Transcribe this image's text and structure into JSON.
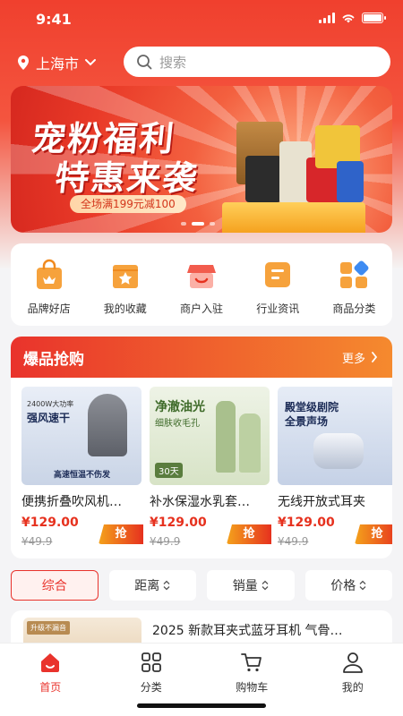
{
  "status": {
    "time": "9:41"
  },
  "location": {
    "city": "上海市"
  },
  "search": {
    "placeholder": "搜索"
  },
  "banner": {
    "title_line1": "宠粉福利",
    "title_line2": "特惠来袭",
    "promo": "全场满199元减100",
    "slide_count": 3,
    "active_slide": 2
  },
  "categories": [
    {
      "label": "品牌好店",
      "icon": "shop-bag-icon"
    },
    {
      "label": "我的收藏",
      "icon": "star-folder-icon"
    },
    {
      "label": "商户入驻",
      "icon": "store-awning-icon"
    },
    {
      "label": "行业资讯",
      "icon": "news-icon"
    },
    {
      "label": "商品分类",
      "icon": "grid-category-icon"
    }
  ],
  "hot_sale": {
    "title": "爆品抢购",
    "more": "更多",
    "grab_label": "抢",
    "products": [
      {
        "name": "便携折叠吹风机…",
        "price": "¥129.00",
        "original": "¥49.9",
        "img_text1": "2400W大功率",
        "img_text2": "强风速干",
        "img_text3": "高速恒温不伤发"
      },
      {
        "name": "补水保湿水乳套…",
        "price": "¥129.00",
        "original": "¥49.9",
        "img_text1": "净澈油光",
        "img_text2": "细肤收毛孔",
        "img_text3": "30天"
      },
      {
        "name": "无线开放式耳夹",
        "price": "¥129.00",
        "original": "¥49.9",
        "img_text1": "殿堂级剧院",
        "img_text2": "全景声场",
        "img_text3": ""
      }
    ]
  },
  "filters": [
    {
      "label": "综合",
      "active": true
    },
    {
      "label": "距离",
      "active": false
    },
    {
      "label": "销量",
      "active": false
    },
    {
      "label": "价格",
      "active": false
    }
  ],
  "list": [
    {
      "name": "2025 新款耳夹式蓝牙耳机 气骨…",
      "thumb_tag": "升级不漏音"
    }
  ],
  "tabbar": [
    {
      "label": "首页",
      "icon": "home-icon",
      "active": true
    },
    {
      "label": "分类",
      "icon": "grid-icon",
      "active": false
    },
    {
      "label": "购物车",
      "icon": "cart-icon",
      "active": false
    },
    {
      "label": "我的",
      "icon": "user-icon",
      "active": false
    }
  ],
  "colors": {
    "accent": "#e9332c",
    "price": "#e6311e",
    "header_gradient_end": "#f58a2e"
  }
}
